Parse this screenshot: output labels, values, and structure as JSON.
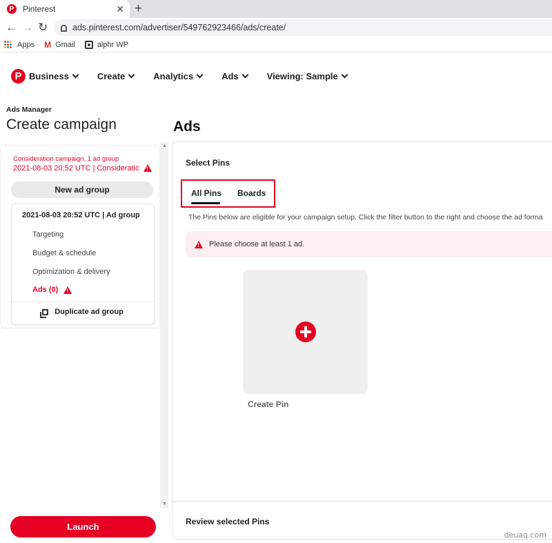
{
  "browser": {
    "tab_title": "Pinterest",
    "url": "ads.pinterest.com/advertiser/549762923466/ads/create/",
    "bookmarks": [
      "Apps",
      "Gmail",
      "alphr WP"
    ]
  },
  "nav": {
    "items": [
      "Business",
      "Create",
      "Analytics",
      "Ads",
      "Viewing: Sample"
    ]
  },
  "sidebar": {
    "section_label": "Ads Manager",
    "page_title": "Create campaign",
    "campaign_line1": "Consideration campaign, 1 ad group",
    "campaign_line2": "2021-08-03 20:52 UTC | Consideratio...",
    "new_ad_group": "New ad group",
    "ad_group": {
      "title": "2021-08-03 20:52 UTC | Ad group",
      "items": [
        "Targeting",
        "Budget & schedule",
        "Optimization & delivery",
        "Ads (0)"
      ],
      "duplicate": "Duplicate ad group"
    },
    "launch": "Launch"
  },
  "main": {
    "title": "Ads",
    "select_pins": "Select Pins",
    "tabs": [
      "All Pins",
      "Boards"
    ],
    "description": "The Pins below are eligible for your campaign setup. Click the filter button to the right and choose the ad forma",
    "alert": "Please choose at least 1 ad.",
    "create_pin": "Create Pin",
    "review": "Review selected Pins"
  },
  "watermark": "deuaq.com",
  "colors": {
    "accent": "#e60023",
    "alert_bg": "#fdeef0"
  }
}
